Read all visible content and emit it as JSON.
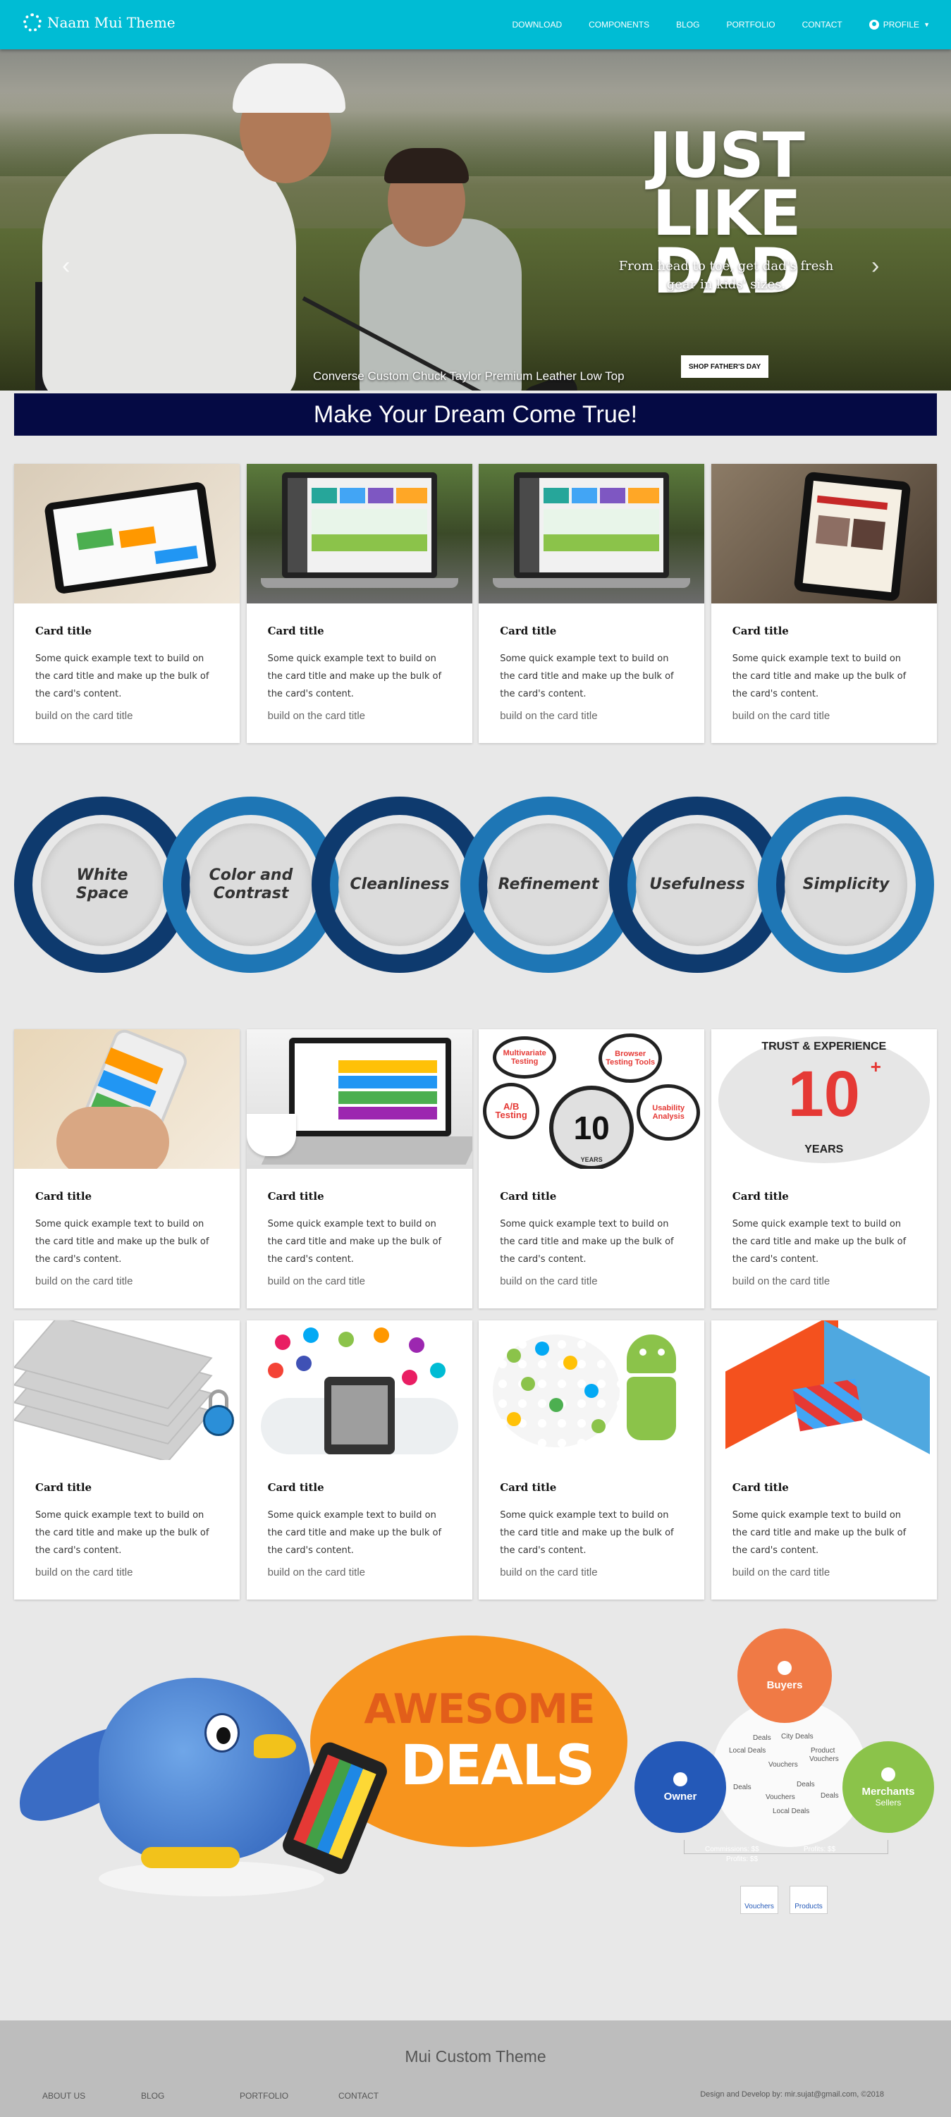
{
  "nav": {
    "brand": "Naam Mui Theme",
    "items": [
      "DOWNLOAD",
      "COMPONENTS",
      "BLOG",
      "PORTFOLIO",
      "CONTACT"
    ],
    "profile": "PROFILE"
  },
  "hero": {
    "title_line1": "JUST LIKE",
    "title_line2": "DAD",
    "subtitle_line1": "From head to toe, get dad's fresh",
    "subtitle_line2": "gear in kids' sizes.",
    "button": "SHOP FATHER'S DAY",
    "caption": "Converse Custom Chuck Taylor Premium Leather Low Top",
    "slides": 3,
    "active_slide": 2
  },
  "banner": "Make Your Dream Come True!",
  "cards": [
    {
      "title": "Card title",
      "text": "Some quick example text to build on the card title and make up the bulk of the card's content.",
      "sub": "build on the card title"
    },
    {
      "title": "Card title",
      "text": "Some quick example text to build on the card title and make up the bulk of the card's content.",
      "sub": "build on the card title"
    },
    {
      "title": "Card title",
      "text": "Some quick example text to build on the card title and make up the bulk of the card's content.",
      "sub": "build on the card title"
    },
    {
      "title": "Card title",
      "text": "Some quick example text to build on the card title and make up the bulk of the card's content.",
      "sub": "build on the card title"
    },
    {
      "title": "Card title",
      "text": "Some quick example text to build on the card title and make up the bulk of the card's content.",
      "sub": "build on the card title"
    },
    {
      "title": "Card title",
      "text": "Some quick example text to build on the card title and make up the bulk of the card's content.",
      "sub": "build on the card title"
    },
    {
      "title": "Card title",
      "text": "Some quick example text to build on the card title and make up the bulk of the card's content.",
      "sub": "build on the card title"
    },
    {
      "title": "Card title",
      "text": "Some quick example text to build on the card title and make up the bulk of the card's content.",
      "sub": "build on the card title"
    },
    {
      "title": "Card title",
      "text": "Some quick example text to build on the card title and make up the bulk of the card's content.",
      "sub": "build on the card title"
    },
    {
      "title": "Card title",
      "text": "Some quick example text to build on the card title and make up the bulk of the card's content.",
      "sub": "build on the card title"
    },
    {
      "title": "Card title",
      "text": "Some quick example text to build on the card title and make up the bulk of the card's content.",
      "sub": "build on the card title"
    },
    {
      "title": "Card title",
      "text": "Some quick example text to build on the card title and make up the bulk of the card's content.",
      "sub": "build on the card title"
    }
  ],
  "card_images": {
    "bubbles": [
      "Multivariate Testing",
      "Browser Testing Tools",
      "A/B Testing",
      "Usability Analysis",
      "10",
      "YEARS"
    ],
    "trust": {
      "top": "TRUST & EXPERIENCE",
      "number": "10",
      "plus": "+",
      "bottom": "YEARS"
    }
  },
  "principles": [
    {
      "line1": "White",
      "line2": "Space"
    },
    {
      "line1": "Color and",
      "line2": "Contrast"
    },
    {
      "line1": "Cleanliness",
      "line2": ""
    },
    {
      "line1": "Refinement",
      "line2": ""
    },
    {
      "line1": "Usefulness",
      "line2": ""
    },
    {
      "line1": "Simplicity",
      "line2": ""
    }
  ],
  "deals": {
    "line1": "AWESOME",
    "line2": "DEALS",
    "buyers": "Buyers",
    "owner": "Owner",
    "merchants": "Merchants",
    "merchants_sub": "Sellers",
    "words": [
      "Deals",
      "City Deals",
      "Local Deals",
      "Product",
      "Vouchers",
      "Vouchers",
      "Deals",
      "Vouchers",
      "Deals",
      "Local Deals",
      "Deals"
    ],
    "revenue": [
      "Commissions: $$",
      "Profits: $$",
      "Profits: $$"
    ],
    "boxes": [
      "Vouchers",
      "Products"
    ]
  },
  "footer": {
    "title": "Mui Custom Theme",
    "links": [
      "ABOUT US",
      "BLOG",
      "PORTFOLIO",
      "CONTACT"
    ],
    "copyright": "Design and Develop by: mir.sujat@gmail.com, ©2018"
  },
  "colors": {
    "nav": "#00bcd4",
    "banner": "#050a44",
    "ring_dark": "#0e3a6e",
    "ring_light": "#1e76b5",
    "deal_orange": "#f7941d"
  }
}
